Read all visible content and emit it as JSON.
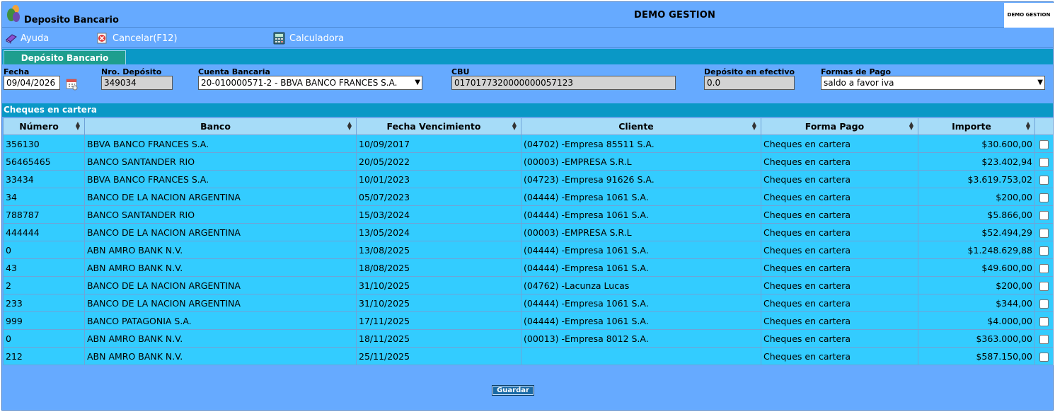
{
  "window": {
    "title": "Deposito Bancario",
    "company": "DEMO GESTION",
    "company_logo_text": "DEMO GESTION"
  },
  "menu": [
    {
      "label": "Ayuda",
      "icon": "help-book-icon"
    },
    {
      "label": "Cancelar(F12)",
      "icon": "cancel-icon"
    },
    {
      "label": "Calculadora",
      "icon": "calculator-icon"
    }
  ],
  "tab": {
    "label": "Depósito Bancario"
  },
  "form": {
    "fecha": {
      "label": "Fecha",
      "value": "09/04/2026"
    },
    "nro_deposito": {
      "label": "Nro. Depósito",
      "value": "349034"
    },
    "cuenta": {
      "label": "Cuenta Bancaria",
      "value": "20-010000571-2 - BBVA BANCO FRANCES S.A."
    },
    "cbu": {
      "label": "CBU",
      "value": "0170177320000000057123"
    },
    "efectivo": {
      "label": "Depósito en efectivo",
      "value": "0.0"
    },
    "formas_pago": {
      "label": "Formas de Pago",
      "value": "saldo a favor iva"
    }
  },
  "cheques": {
    "title": "Cheques en cartera",
    "columns": [
      "Número",
      "Banco",
      "Fecha Vencimiento",
      "Cliente",
      "Forma Pago",
      "Importe"
    ],
    "rows": [
      [
        "356130",
        "BBVA BANCO FRANCES S.A.",
        "10/09/2017",
        "(04702) -Empresa 85511 S.A.",
        "Cheques en cartera",
        "$30.600,00"
      ],
      [
        "56465465",
        "BANCO SANTANDER RIO",
        "20/05/2022",
        "(00003) -EMPRESA S.R.L",
        "Cheques en cartera",
        "$23.402,94"
      ],
      [
        "33434",
        "BBVA BANCO FRANCES S.A.",
        "10/01/2023",
        "(04723) -Empresa 91626 S.A.",
        "Cheques en cartera",
        "$3.619.753,02"
      ],
      [
        "34",
        "BANCO DE LA NACION ARGENTINA",
        "05/07/2023",
        "(04444) -Empresa 1061 S.A.",
        "Cheques en cartera",
        "$200,00"
      ],
      [
        "788787",
        "BANCO SANTANDER RIO",
        "15/03/2024",
        "(04444) -Empresa 1061 S.A.",
        "Cheques en cartera",
        "$5.866,00"
      ],
      [
        "444444",
        "BANCO DE LA NACION ARGENTINA",
        "13/05/2024",
        "(00003) -EMPRESA S.R.L",
        "Cheques en cartera",
        "$52.494,29"
      ],
      [
        "0",
        "ABN AMRO BANK N.V.",
        "13/08/2025",
        "(04444) -Empresa 1061 S.A.",
        "Cheques en cartera",
        "$1.248.629,88"
      ],
      [
        "43",
        "ABN AMRO BANK N.V.",
        "18/08/2025",
        "(04444) -Empresa 1061 S.A.",
        "Cheques en cartera",
        "$49.600,00"
      ],
      [
        "2",
        "BANCO DE LA NACION ARGENTINA",
        "31/10/2025",
        "(04762) -Lacunza Lucas",
        "Cheques en cartera",
        "$200,00"
      ],
      [
        "233",
        "BANCO DE LA NACION ARGENTINA",
        "31/10/2025",
        "(04444) -Empresa 1061 S.A.",
        "Cheques en cartera",
        "$344,00"
      ],
      [
        "999",
        "BANCO PATAGONIA S.A.",
        "17/11/2025",
        "(04444) -Empresa 1061 S.A.",
        "Cheques en cartera",
        "$4.000,00"
      ],
      [
        "0",
        "ABN AMRO BANK N.V.",
        "18/11/2025",
        "(00013) -Empresa 8012 S.A.",
        "Cheques en cartera",
        "$363.000,00"
      ],
      [
        "212",
        "ABN AMRO BANK N.V.",
        "25/11/2025",
        "",
        "Cheques en cartera",
        "$587.150,00"
      ]
    ]
  },
  "actions": {
    "save_label": "Guardar"
  },
  "colors": {
    "background": "#66aaff",
    "header_band": "#0a98c6",
    "row": "#33ccff",
    "header_cell": "#a6dcf8",
    "tab": "#1e9e8e"
  }
}
